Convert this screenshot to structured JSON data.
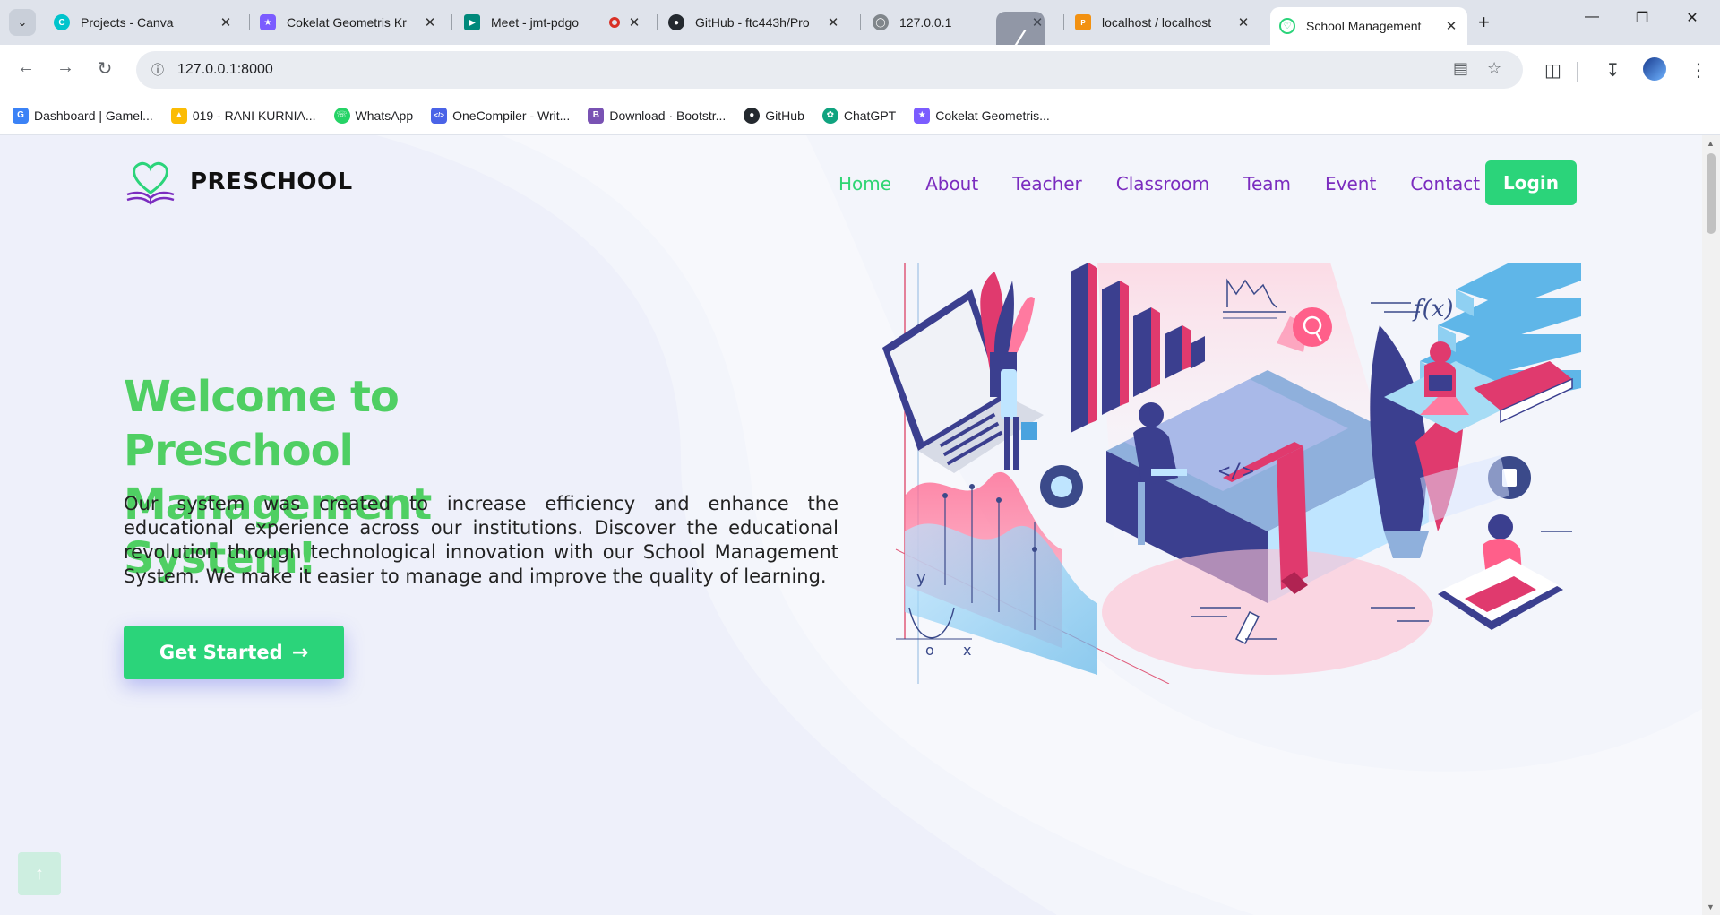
{
  "browser": {
    "tabs": [
      {
        "title": "Projects - Canva",
        "icon": "canva-icon",
        "color": "#00c4cc"
      },
      {
        "title": "Cokelat Geometris Kr",
        "icon": "badge-icon",
        "color": "#7b5cff"
      },
      {
        "title": "Meet - jmt-pdgo",
        "icon": "meet-icon",
        "color": "#00897b"
      },
      {
        "title": "GitHub - ftc443h/Pro",
        "icon": "github-icon",
        "color": "#24292f"
      },
      {
        "title": "127.0.0.1",
        "icon": "globe-icon",
        "color": "#80868b"
      },
      {
        "title": "localhost / localhost",
        "icon": "phpmyadmin-icon",
        "color": "#f29111"
      },
      {
        "title": "School Management",
        "icon": "school-logo-icon",
        "color": "#2bd47a"
      }
    ],
    "url": "127.0.0.1:8000",
    "bookmarks": [
      {
        "label": "Dashboard | Gamel...",
        "icon": "dashboard-icon",
        "color": "#3b82f6"
      },
      {
        "label": "019 - RANI KURNIA...",
        "icon": "drive-icon",
        "color": "#fbbc04"
      },
      {
        "label": "WhatsApp",
        "icon": "whatsapp-icon",
        "color": "#25d366"
      },
      {
        "label": "OneCompiler - Writ...",
        "icon": "code-icon",
        "color": "#4a63e7"
      },
      {
        "label": "Download · Bootstr...",
        "icon": "bootstrap-icon",
        "color": "#7952b3"
      },
      {
        "label": "GitHub",
        "icon": "github-icon",
        "color": "#24292f"
      },
      {
        "label": "ChatGPT",
        "icon": "chatgpt-icon",
        "color": "#10a37f"
      },
      {
        "label": "Cokelat Geometris...",
        "icon": "badge-icon",
        "color": "#7b5cff"
      }
    ]
  },
  "site": {
    "brand": "PRESCHOOL",
    "nav": [
      "Home",
      "About",
      "Teacher",
      "Classroom",
      "Team",
      "Event",
      "Contact"
    ],
    "login_label": "Login",
    "hero_title": "Welcome to Preschool Management System!",
    "hero_text": "Our system was created to increase efficiency and enhance the educational experience across our institutions. Discover the educational revolution through technological innovation with our School Management System. We make it easier to manage and improve the quality of learning.",
    "cta_label": "Get Started",
    "illustration_labels": {
      "code": "</>",
      "fx": "f(x)",
      "y": "y",
      "o": "o",
      "x": "x"
    }
  },
  "colors": {
    "accent_green": "#2bd47a",
    "title_green": "#4fcf63",
    "nav_purple": "#7b2cbf"
  }
}
